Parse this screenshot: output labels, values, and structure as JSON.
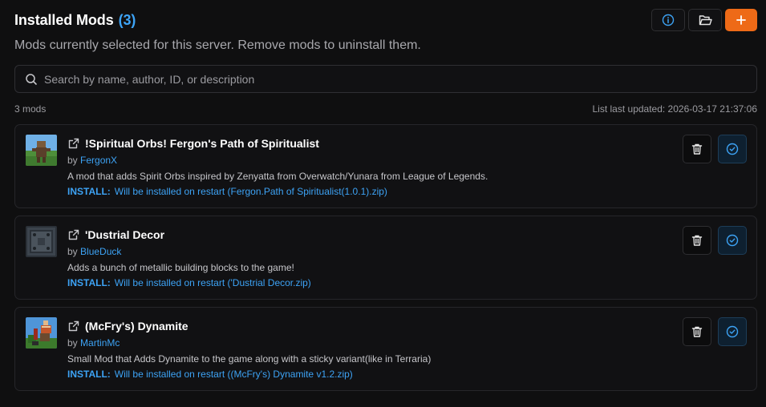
{
  "header": {
    "title": "Installed Mods",
    "count": "(3)",
    "subtitle": "Mods currently selected for this server. Remove mods to uninstall them."
  },
  "toolbar": {
    "info_icon": "info-icon",
    "folder_icon": "folder-icon",
    "add_icon": "plus-icon",
    "accent": "#ee6a17"
  },
  "search": {
    "placeholder": "Search by name, author, ID, or description",
    "value": ""
  },
  "meta": {
    "mods_count": "3 mods",
    "last_updated": "List last updated: 2026-03-17 21:37:06"
  },
  "mods": [
    {
      "name": "!Spiritual Orbs! Fergon's Path of Spiritualist",
      "by": "by",
      "author": "FergonX",
      "description": "A mod that adds Spirit Orbs inspired by Zenyatta from Overwatch/Yunara from League of Legends.",
      "install_tag": "INSTALL:",
      "install_text": "Will be installed on restart (Fergon.Path of Spiritualist(1.0.1).zip)"
    },
    {
      "name": "'Dustrial Decor",
      "by": "by",
      "author": "BlueDuck",
      "description": "Adds a bunch of metallic building blocks to the game!",
      "install_tag": "INSTALL:",
      "install_text": "Will be installed on restart ('Dustrial Decor.zip)"
    },
    {
      "name": "(McFry's) Dynamite",
      "by": "by",
      "author": "MartinMc",
      "description": "Small Mod that Adds Dynamite to the game along with a sticky variant(like in Terraria)",
      "install_tag": "INSTALL:",
      "install_text": "Will be installed on restart ((McFry's) Dynamite v1.2.zip)"
    }
  ],
  "colors": {
    "link": "#3da3f5",
    "background": "#0f0f10",
    "card": "#111113"
  }
}
